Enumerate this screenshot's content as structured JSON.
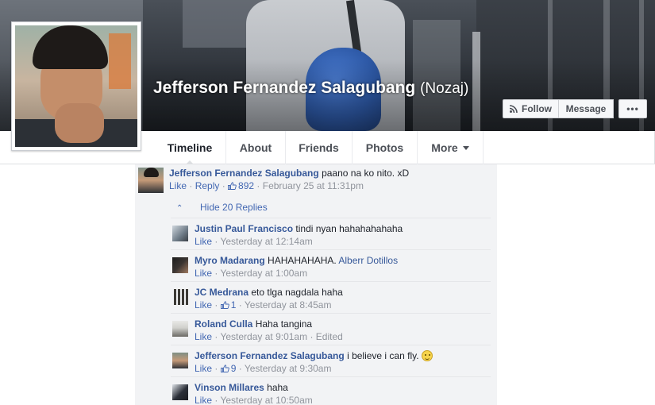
{
  "profile": {
    "name": "Jefferson Fernandez Salagubang",
    "alternate_name": "(Nozaj)"
  },
  "cover_actions": {
    "follow": "Follow",
    "message": "Message",
    "more": "•••"
  },
  "tabs": [
    {
      "label": "Timeline",
      "active": true
    },
    {
      "label": "About"
    },
    {
      "label": "Friends"
    },
    {
      "label": "Photos"
    },
    {
      "label": "More"
    }
  ],
  "main_comment": {
    "author": "Jefferson Fernandez Salagubang",
    "text": "paano na ko nito. xD",
    "like": "Like",
    "reply": "Reply",
    "likes": "892",
    "time": "February 25 at 11:31pm"
  },
  "hide_replies": "Hide 20 Replies",
  "replies": [
    {
      "author": "Justin Paul Francisco",
      "text": "tindi nyan hahahahahaha",
      "like": "Like",
      "time": "Yesterday at 12:14am"
    },
    {
      "author": "Myro Madarang",
      "text": "HAHAHAHAHA.",
      "mention": "Alberr Dotillos",
      "like": "Like",
      "time": "Yesterday at 1:00am"
    },
    {
      "author": "JC Medrana",
      "text": "eto tlga nagdala haha",
      "like": "Like",
      "likes": "1",
      "time": "Yesterday at 8:45am"
    },
    {
      "author": "Roland Culla",
      "text": "Haha tangina",
      "like": "Like",
      "time": "Yesterday at 9:01am",
      "edited": "Edited"
    },
    {
      "author": "Jefferson Fernandez Salagubang",
      "text": "i believe i can fly.",
      "emoji": "smile-emoji",
      "like": "Like",
      "likes": "9",
      "time": "Yesterday at 9:30am"
    },
    {
      "author": "Vinson Millares",
      "text": "haha",
      "like": "Like",
      "time": "Yesterday at 10:50am"
    }
  ],
  "colors": {
    "link": "#365899",
    "action_link": "#4267b2",
    "meta": "#90949c",
    "comment_bg": "#f2f3f5"
  }
}
